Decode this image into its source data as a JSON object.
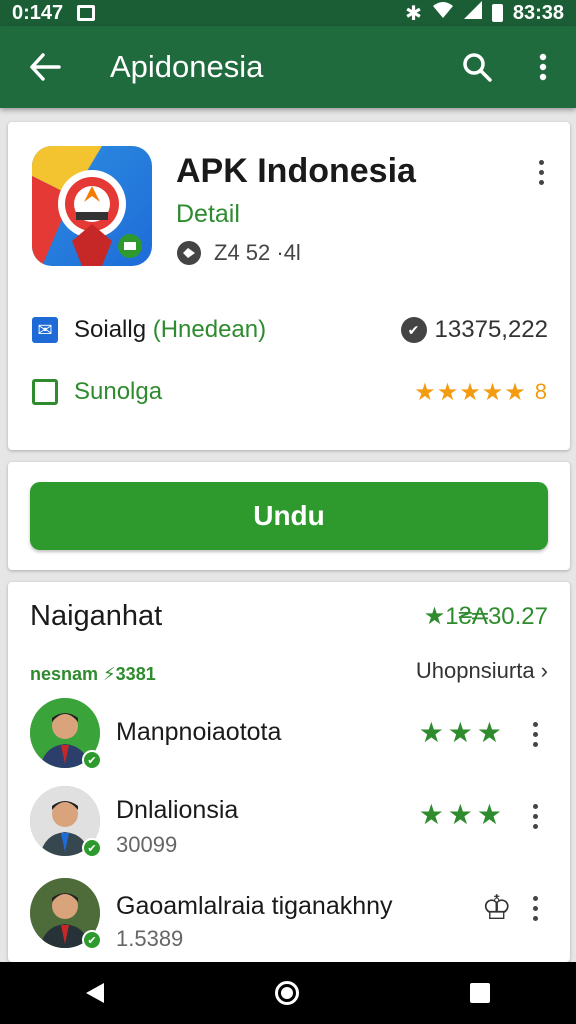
{
  "status_bar": {
    "time_left": "0:147",
    "time_right": "83:38"
  },
  "app_bar": {
    "title": "Apidonesia"
  },
  "app_card": {
    "title": "APK Indonesia",
    "subtitle": "Detail",
    "meta": "Z4 52 ·4l",
    "row1": {
      "label": "Soiallg",
      "label_highlight": "(Hnedean)",
      "value": "13375,222"
    },
    "row2": {
      "label": "Sunolga",
      "stars": "★★★★★",
      "stars_value": "8"
    }
  },
  "download": {
    "label": "Undu"
  },
  "list": {
    "title": "Naiganhat",
    "top_right": "★1₴₳30.27",
    "sub_left": "nesnam ⚡3381",
    "sub_right": "Uhopnsiurta ›",
    "rows": [
      {
        "name": "Manpnoiaotota",
        "sub": "",
        "stars": "★★★"
      },
      {
        "name": "Dnlalionsia",
        "sub": "30099",
        "stars": "★★★"
      },
      {
        "name": "Gaoamlalraia tiganakhny",
        "sub": "1.5389",
        "icon": "♔"
      }
    ]
  },
  "colors": {
    "primary": "#1f6b3e",
    "accent": "#2e9a2e",
    "star_orange": "#f39c12",
    "brand_blue": "#1e6bd8"
  }
}
